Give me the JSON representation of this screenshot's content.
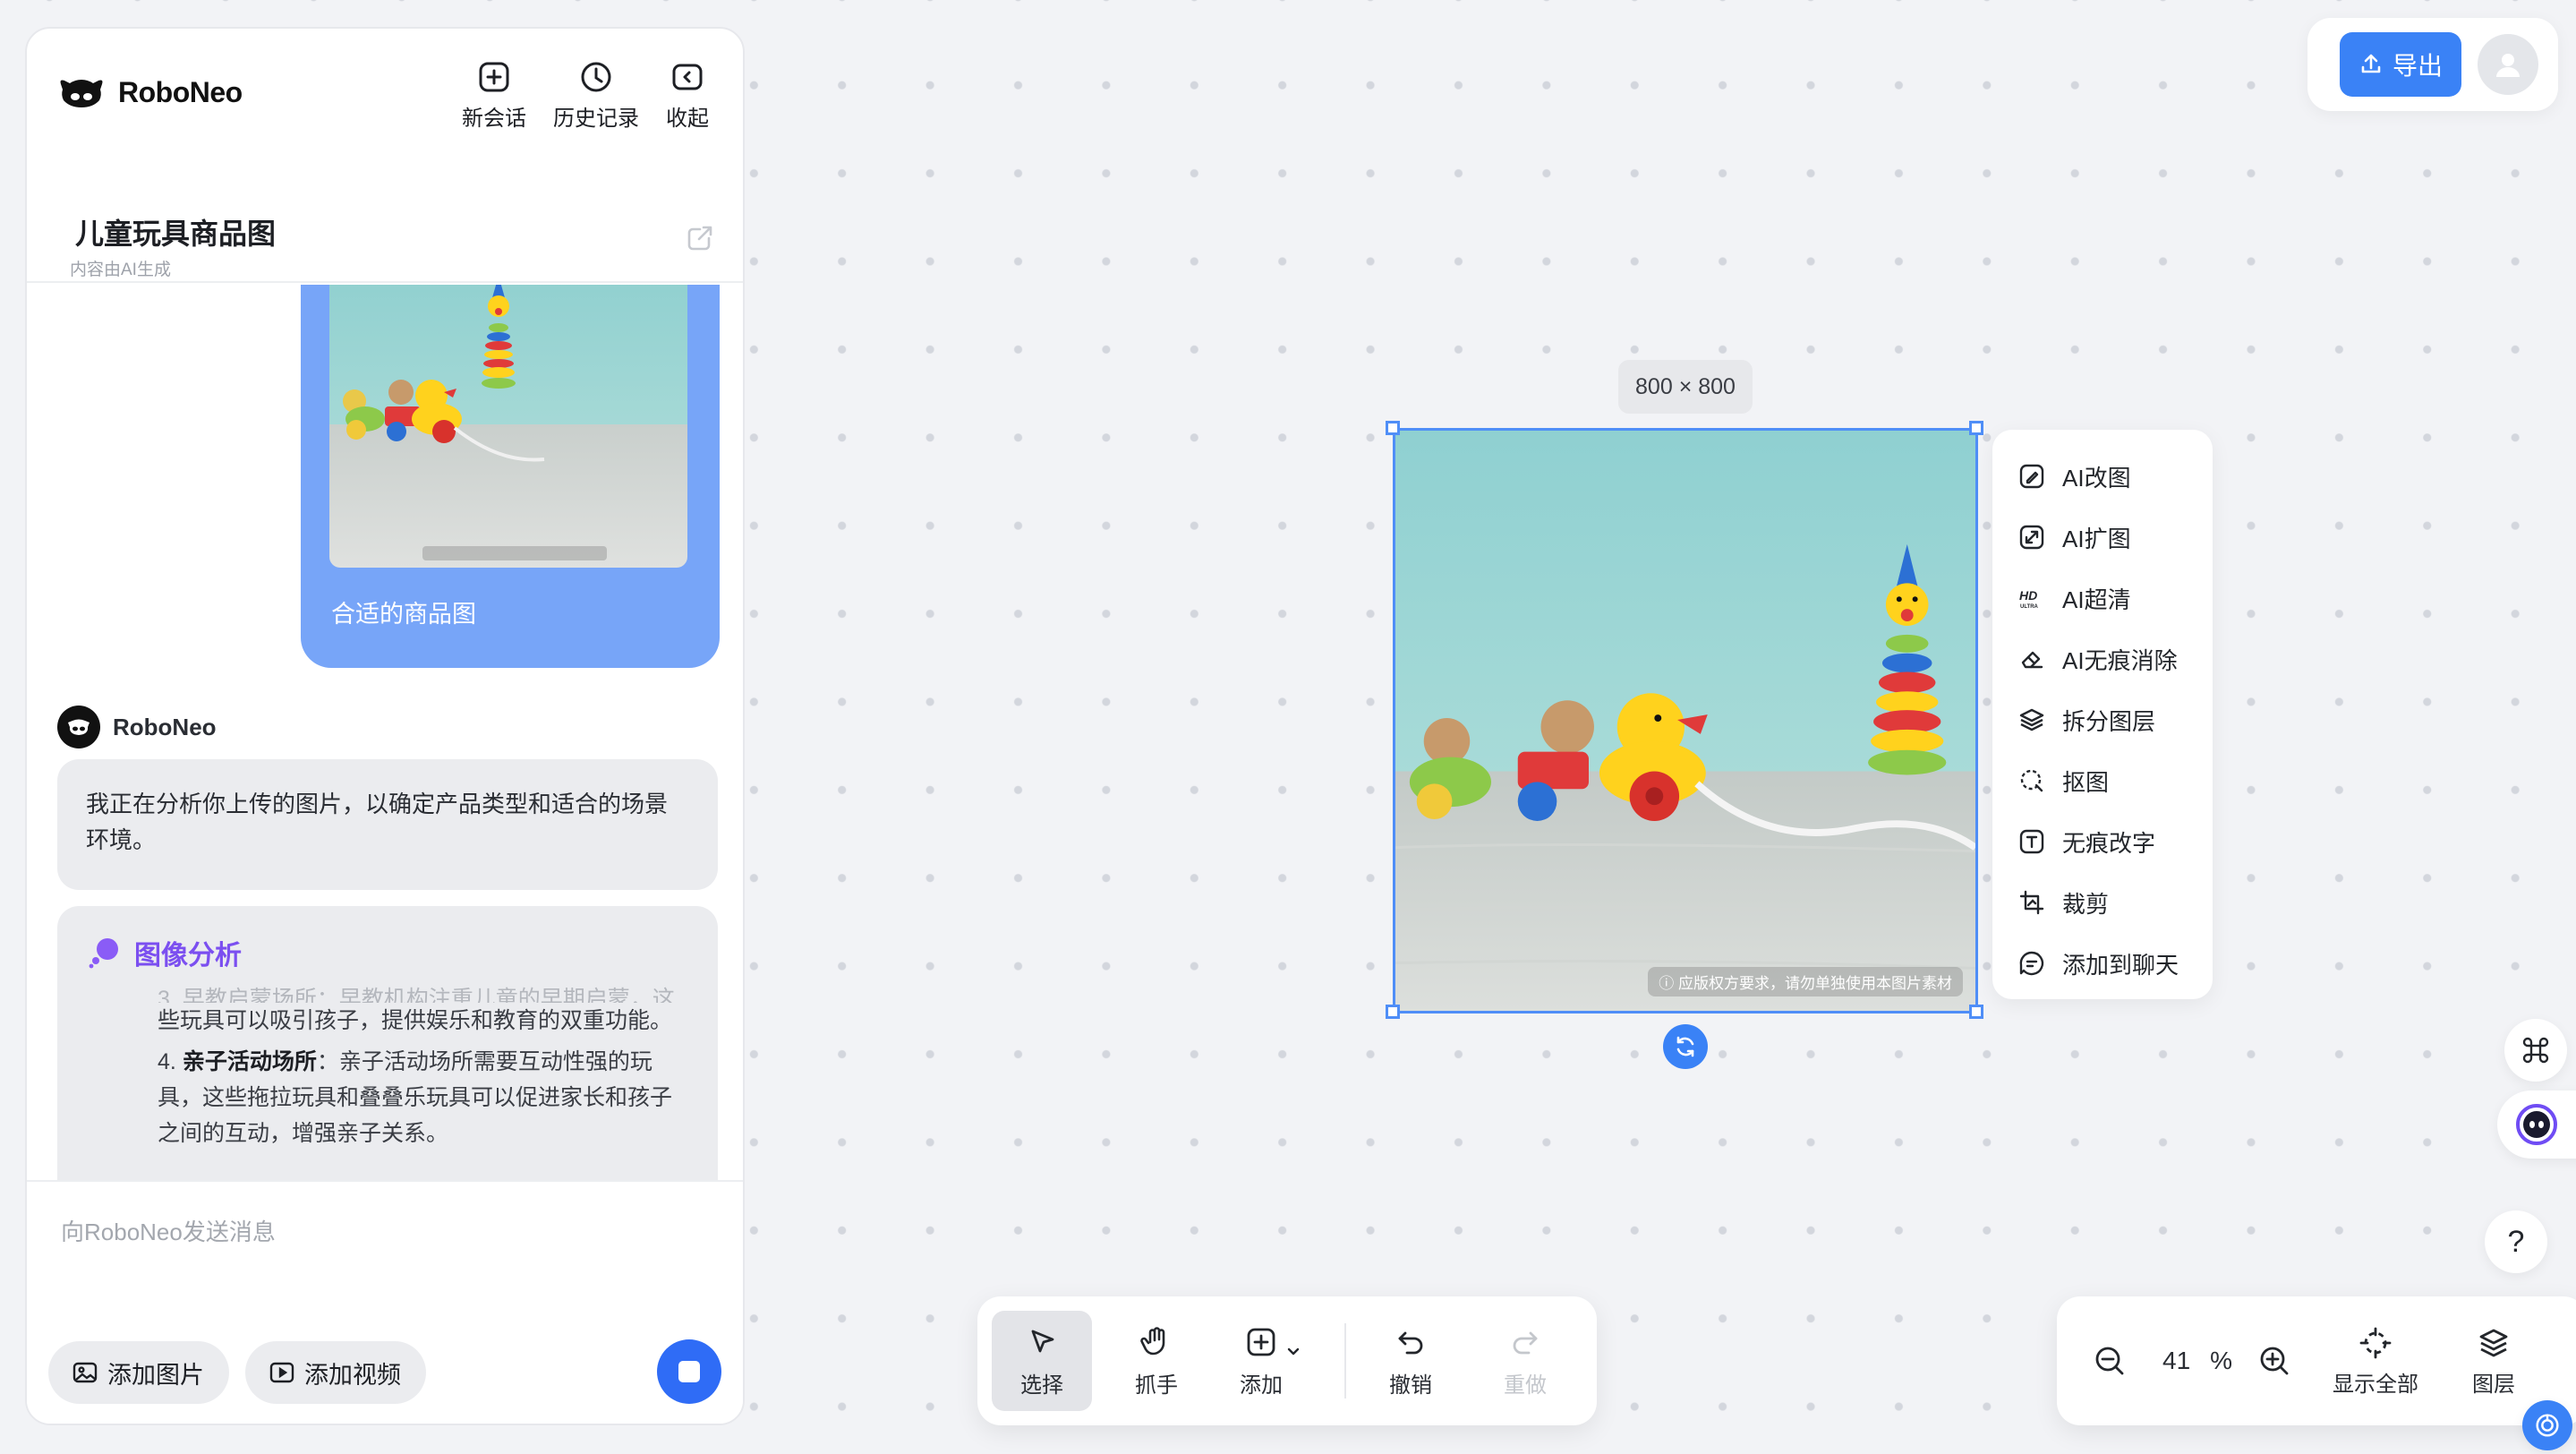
{
  "header": {
    "brand": "RoboNeo",
    "actions": [
      {
        "label": "新会话",
        "icon": "plus-square-icon"
      },
      {
        "label": "历史记录",
        "icon": "clock-icon"
      },
      {
        "label": "收起",
        "icon": "collapse-icon"
      }
    ]
  },
  "conversation": {
    "title": "儿童玩具商品图",
    "subtitle": "内容由AI生成"
  },
  "messages": {
    "user_caption": "合适的商品图",
    "user_image_watermark": "ⓘ 应版权方要求，请勿单独使用本图片素材",
    "bot_name": "RoboNeo",
    "bot_text": "我正在分析你上传的图片，以确定产品类型和适合的场景环境。",
    "analysis": {
      "title": "图像分析",
      "faded_line": "3. 早教启蒙场所：早教机构注重儿童的早期启蒙，这",
      "line_1": "些玩具可以吸引孩子，提供娱乐和教育的双重功能。",
      "item_number": "4.",
      "item_heading": "亲子活动场所",
      "item_text": "：亲子活动场所需要互动性强的玩具，这些拖拉玩具和叠叠乐玩具可以促进家长和孩子之间的互动，增强亲子关系。"
    }
  },
  "composer": {
    "placeholder": "向RoboNeo发送消息",
    "add_image": "添加图片",
    "add_video": "添加视频"
  },
  "canvas": {
    "size_label": "800 × 800",
    "watermark": "ⓘ 应版权方要求，请勿单独使用本图片素材",
    "tools": [
      {
        "label": "AI改图",
        "icon": "ai-edit-icon"
      },
      {
        "label": "AI扩图",
        "icon": "ai-expand-icon"
      },
      {
        "label": "AI超清",
        "icon": "hd-ultra-icon"
      },
      {
        "label": "AI无痕消除",
        "icon": "eraser-icon"
      },
      {
        "label": "拆分图层",
        "icon": "layers-split-icon"
      },
      {
        "label": "抠图",
        "icon": "cutout-icon"
      },
      {
        "label": "无痕改字",
        "icon": "text-edit-icon"
      },
      {
        "label": "裁剪",
        "icon": "crop-icon"
      },
      {
        "label": "添加到聊天",
        "icon": "add-to-chat-icon"
      }
    ]
  },
  "topbar": {
    "export_label": "导出"
  },
  "toolbar": {
    "select": "选择",
    "hand": "抓手",
    "add": "添加",
    "undo": "撤销",
    "redo": "重做"
  },
  "zoom": {
    "value": "41",
    "unit": "%",
    "fit_all": "显示全部",
    "layers": "图层"
  },
  "help": {
    "label": "?"
  },
  "colors": {
    "accent": "#3a82f6",
    "user_bubble": "#77a5f8",
    "analysis_title": "#7b4ff0"
  }
}
